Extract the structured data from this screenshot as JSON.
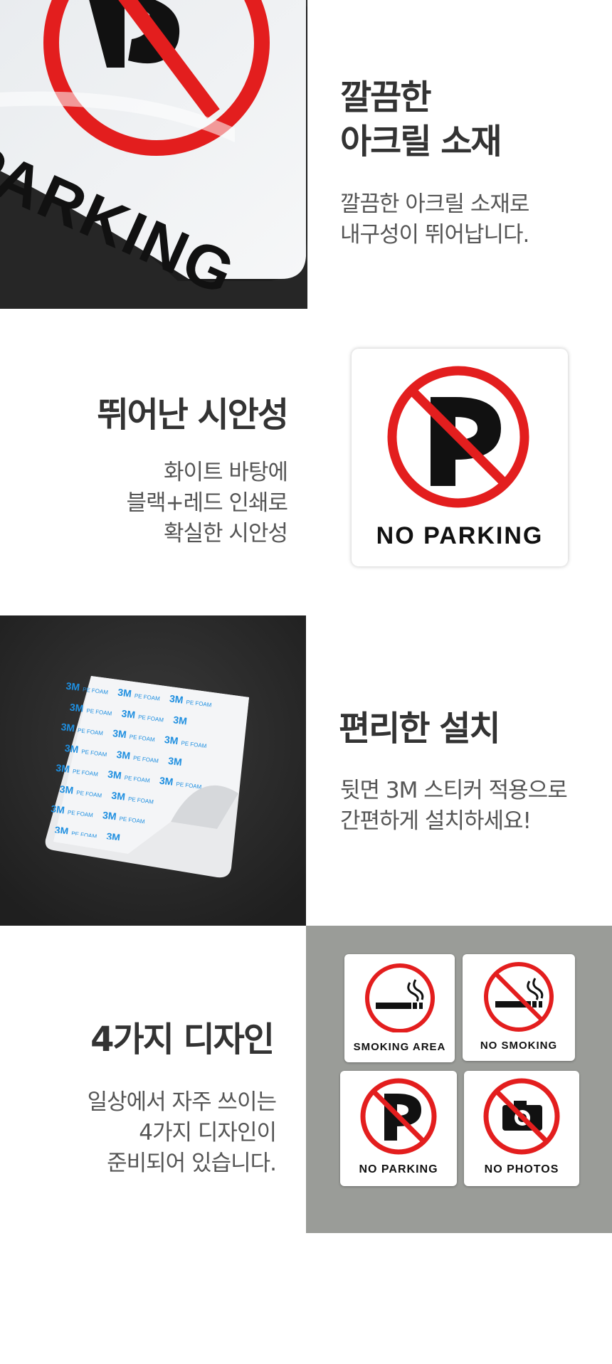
{
  "sections": [
    {
      "title_lines": [
        "깔끔한",
        "아크릴 소재"
      ],
      "desc_lines": [
        "깔끔한 아크릴 소재로",
        "내구성이 뛰어납니다."
      ],
      "photo": {
        "sign_text": "PARKING",
        "icon": "no-parking-icon"
      }
    },
    {
      "title_lines": [
        "뛰어난 시안성"
      ],
      "desc_lines": [
        "화이트 바탕에",
        "블랙+레드 인쇄로",
        "확실한 시안성"
      ],
      "photo": {
        "sign_text": "NO PARKING",
        "icon": "no-parking-icon"
      }
    },
    {
      "title_lines": [
        "편리한 설치"
      ],
      "desc_lines": [
        "뒷면 3M 스티커 적용으로",
        "간편하게 설치하세요!"
      ],
      "photo": {
        "brand": "3M",
        "foam_label": "PE FOAM",
        "icon": "adhesive-backing-icon"
      }
    },
    {
      "title_lines": [
        "4가지 디자인"
      ],
      "desc_lines": [
        "일상에서 자주 쓰이는",
        "4가지 디자인이",
        "준비되어 있습니다."
      ],
      "photo": {
        "signs": [
          {
            "label": "SMOKING AREA",
            "icon": "smoking-icon"
          },
          {
            "label": "NO SMOKING",
            "icon": "no-smoking-icon"
          },
          {
            "label": "NO PARKING",
            "icon": "no-parking-icon"
          },
          {
            "label": "NO PHOTOS",
            "icon": "no-photos-icon"
          }
        ]
      }
    }
  ],
  "colors": {
    "prohibition_red": "#e31e1e",
    "dark_background": "#2a2a2a",
    "grey_background": "#9a9c98",
    "heading_text": "#333333",
    "body_text": "#555555"
  }
}
